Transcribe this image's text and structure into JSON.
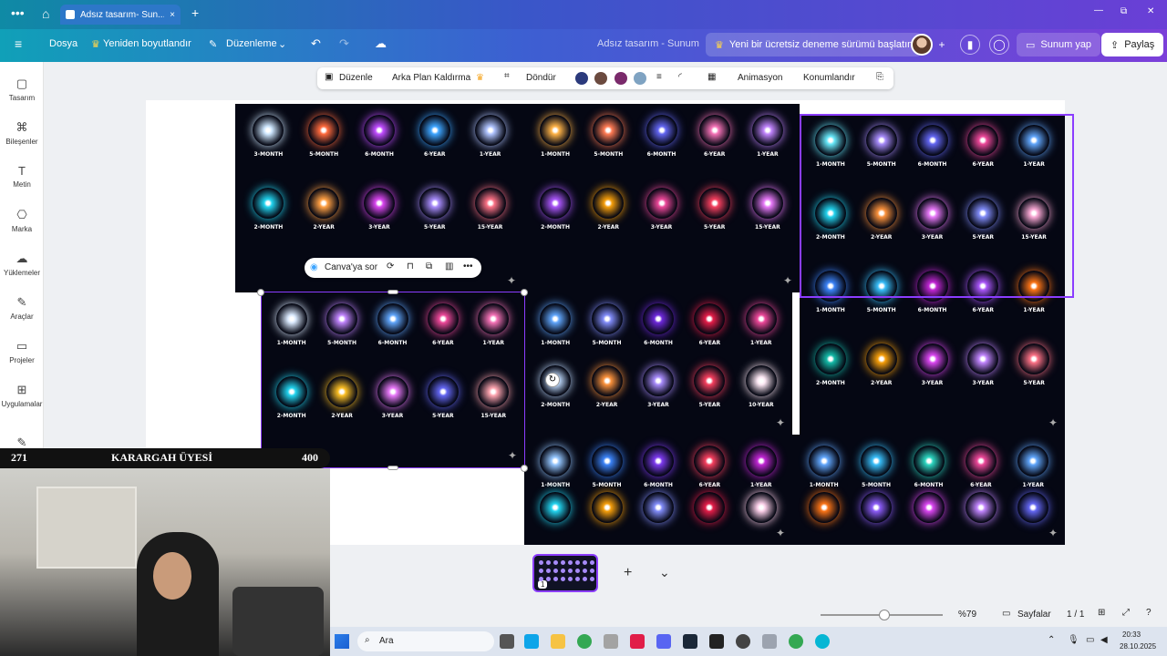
{
  "tabbar": {
    "tab_title": "Adsız tasarım- Sun...",
    "close": "×",
    "add": "+",
    "minimize": "—",
    "restore": "⧉",
    "close_window": "✕"
  },
  "header": {
    "menu": "Dosya",
    "resize": "Yeniden boyutlandır",
    "edit": "Düzenleme",
    "doc_title": "Adsız tasarım - Sunum",
    "trial": "Yeni bir ücretsiz deneme sürümü başlatın",
    "present": "Sunum yap",
    "share": "Paylaş"
  },
  "sidebar": {
    "items": [
      {
        "label": "Tasarım",
        "icon": "▢"
      },
      {
        "label": "Bileşenler",
        "icon": "⌘"
      },
      {
        "label": "Metin",
        "icon": "T"
      },
      {
        "label": "Marka",
        "icon": "⎔"
      },
      {
        "label": "Yüklemeler",
        "icon": "☁"
      },
      {
        "label": "Araçlar",
        "icon": "✎"
      },
      {
        "label": "Projeler",
        "icon": "▭"
      },
      {
        "label": "Uygulamalar",
        "icon": "⊞"
      }
    ]
  },
  "context_toolbar": {
    "edit": "Düzenle",
    "bg_remove": "Arka Plan Kaldırma",
    "rotate": "Döndür",
    "animate": "Animasyon",
    "position": "Konumlandır",
    "colors": [
      "#2b3a7c",
      "#6b4a3f",
      "#7a2a6b",
      "#7fa3c2"
    ]
  },
  "ask_bar": {
    "label": "Canva'ya sor"
  },
  "tiles": [
    {
      "rows": [
        {
          "labels": [
            "3-MONTH",
            "5-MONTH",
            "6-MONTH",
            "6-YEAR",
            "1-YEAR"
          ],
          "colors": [
            "#cfe8ff",
            "#ff6a3d",
            "#c04dff",
            "#3da5ff",
            "#b0c4ff"
          ]
        },
        {
          "labels": [
            "2-MONTH",
            "2-YEAR",
            "3-YEAR",
            "5-YEAR",
            "15-YEAR"
          ],
          "colors": [
            "#22d3ee",
            "#ff9f43",
            "#d946ef",
            "#a78bfa",
            "#fb7185"
          ]
        }
      ]
    },
    {
      "rows": [
        {
          "labels": [
            "1-MONTH",
            "5-MONTH",
            "6-MONTH",
            "6-YEAR",
            "1-YEAR"
          ],
          "colors": [
            "#ffb347",
            "#ff7b54",
            "#6366f1",
            "#f472b6",
            "#c084fc"
          ]
        },
        {
          "labels": [
            "2-MONTH",
            "2-YEAR",
            "3-YEAR",
            "5-YEAR",
            "15-YEAR"
          ],
          "colors": [
            "#a855f7",
            "#f59e0b",
            "#ec4899",
            "#f43f5e",
            "#e879f9"
          ]
        }
      ]
    },
    {
      "rows": [
        {
          "labels": [
            "1-MONTH",
            "5-MONTH",
            "6-MONTH",
            "6-YEAR",
            "1-YEAR"
          ],
          "colors": [
            "#67e8f9",
            "#a78bfa",
            "#6366f1",
            "#ec4899",
            "#60a5fa"
          ]
        },
        {
          "labels": [
            "2-MONTH",
            "2-YEAR",
            "3-YEAR",
            "5-YEAR",
            "15-YEAR"
          ],
          "colors": [
            "#22d3ee",
            "#fb923c",
            "#e879f9",
            "#818cf8",
            "#f9a8d4"
          ]
        },
        {
          "labels": [
            "1-MONTH",
            "5-MONTH",
            "6-MONTH",
            "6-YEAR",
            "1-YEAR"
          ],
          "colors": [
            "#3b82f6",
            "#38bdf8",
            "#c026d3",
            "#a855f7",
            "#f97316"
          ]
        },
        {
          "labels": [
            "2-MONTH",
            "2-YEAR",
            "3-YEAR",
            "3-YEAR",
            "5-YEAR"
          ],
          "colors": [
            "#14b8a6",
            "#f59e0b",
            "#d946ef",
            "#c084fc",
            "#fb7185"
          ]
        }
      ]
    },
    {
      "rows": [
        {
          "labels": [
            "1-MONTH",
            "5-MONTH",
            "6-MONTH",
            "6-YEAR",
            "1-YEAR"
          ],
          "colors": [
            "#dbeafe",
            "#c084fc",
            "#60a5fa",
            "#ec4899",
            "#f472b6"
          ]
        },
        {
          "labels": [
            "2-MONTH",
            "2-YEAR",
            "3-YEAR",
            "5-YEAR",
            "15-YEAR"
          ],
          "colors": [
            "#22d3ee",
            "#fbbf24",
            "#e879f9",
            "#6366f1",
            "#fda4af"
          ]
        }
      ]
    },
    {
      "rows": [
        {
          "labels": [
            "1-MONTH",
            "5-MONTH",
            "6-MONTH",
            "6-YEAR",
            "1-YEAR"
          ],
          "colors": [
            "#60a5fa",
            "#818cf8",
            "#6d28d9",
            "#e11d48",
            "#ec4899"
          ]
        },
        {
          "labels": [
            "2-MONTH",
            "2-YEAR",
            "3-YEAR",
            "5-YEAR",
            "10-YEAR"
          ],
          "colors": [
            "#bfdbfe",
            "#fb923c",
            "#a78bfa",
            "#f43f5e",
            "#fce7f3"
          ]
        }
      ]
    },
    {
      "rows": [
        {
          "labels": [
            "1-MONTH",
            "5-MONTH",
            "6-MONTH",
            "6-YEAR",
            "1-YEAR"
          ],
          "colors": [
            "#93c5fd",
            "#3b82f6",
            "#7c3aed",
            "#f43f5e",
            "#c026d3"
          ]
        },
        {
          "labels": [
            "",
            "",
            "",
            "",
            ""
          ],
          "colors": [
            "#22d3ee",
            "#f59e0b",
            "#818cf8",
            "#e11d48",
            "#fbcfe8"
          ]
        }
      ]
    },
    {
      "rows": [
        {
          "labels": [
            "1-MONTH",
            "5-MONTH",
            "6-MONTH",
            "6-YEAR",
            "1-YEAR"
          ],
          "colors": [
            "#60a5fa",
            "#38bdf8",
            "#2dd4bf",
            "#ec4899",
            "#60a5fa"
          ]
        },
        {
          "labels": [
            "",
            "",
            "",
            "",
            ""
          ],
          "colors": [
            "#f97316",
            "#8b5cf6",
            "#d946ef",
            "#c084fc",
            "#6366f1"
          ]
        }
      ]
    }
  ],
  "pages": {
    "badge": "1",
    "add": "+",
    "expand": "⌄"
  },
  "bottom": {
    "zoom": "%79",
    "pages_label": "Sayfalar",
    "page_count": "1 / 1",
    "help": "?"
  },
  "overlay": {
    "left": "271",
    "title": "KARARGAH ÜYESİ",
    "right": "400"
  },
  "taskbar": {
    "search": "Ara",
    "time": "20:33",
    "date": "28.10.2025"
  }
}
